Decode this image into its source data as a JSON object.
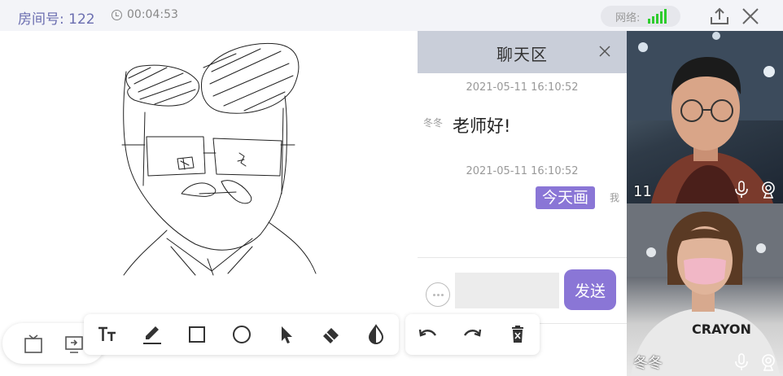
{
  "topbar": {
    "room_label": "房间号: 122",
    "timer": "00:04:53",
    "network_label": "网络:"
  },
  "chat": {
    "title": "聊天区",
    "messages": [
      {
        "timestamp": "2021-05-11 16:10:52",
        "sender": "冬冬",
        "text": "老师好!",
        "direction": "incoming"
      },
      {
        "timestamp": "2021-05-11 16:10:52",
        "sender": "我",
        "text": "今天画",
        "direction": "outgoing"
      }
    ],
    "input_value": "",
    "send_label": "发送"
  },
  "videos": [
    {
      "name": "11"
    },
    {
      "name": "冬冬"
    }
  ],
  "toolbar": {
    "left_tools": [
      "whiteboard-icon",
      "screen-share-icon"
    ],
    "main_tools": [
      "text-size-icon",
      "pen-icon",
      "rectangle-icon",
      "circle-icon",
      "select-arrow-icon",
      "eraser-icon",
      "color-fill-icon"
    ],
    "right_tools": [
      "undo-icon",
      "redo-icon",
      "clear-icon"
    ]
  },
  "colors": {
    "accent": "#8a76d6",
    "room_text": "#6b6eb0",
    "chat_header": "#c9ced9",
    "signal": "#2ecc2e"
  }
}
